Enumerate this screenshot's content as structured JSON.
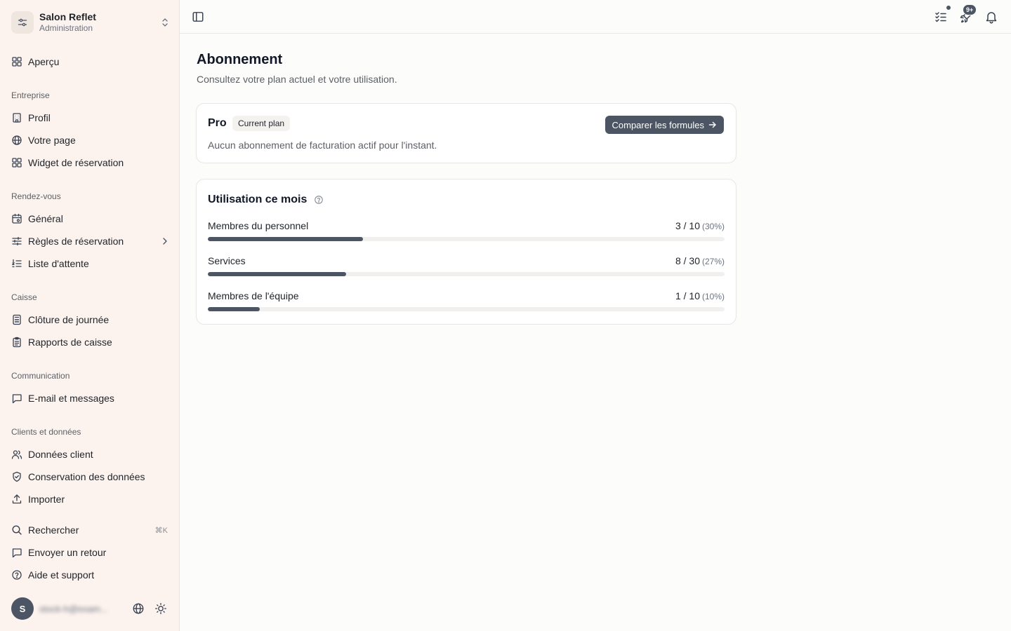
{
  "sidebar": {
    "org_name": "Salon Reflet",
    "org_role": "Administration",
    "overview": "Aperçu",
    "groups": {
      "entreprise": "Entreprise",
      "rendez_vous": "Rendez-vous",
      "caisse": "Caisse",
      "communication": "Communication",
      "clients": "Clients et données"
    },
    "items": {
      "profil": "Profil",
      "votre_page": "Votre page",
      "widget": "Widget de réservation",
      "general": "Général",
      "regles": "Règles de réservation",
      "liste_attente": "Liste d'attente",
      "cloture": "Clôture de journée",
      "rapports": "Rapports de caisse",
      "email": "E-mail et messages",
      "donnees_client": "Données client",
      "conservation": "Conservation des données",
      "importer": "Importer"
    },
    "search": "Rechercher",
    "search_shortcut": "⌘K",
    "feedback": "Envoyer un retour",
    "help": "Aide et support",
    "user_initial": "S",
    "user_email": "stock-h@exam..."
  },
  "topbar": {
    "whats_new_badge": "9+"
  },
  "main": {
    "title": "Abonnement",
    "subtitle": "Consultez votre plan actuel et votre utilisation.",
    "plan": {
      "name": "Pro",
      "badge": "Current plan",
      "compare_label": "Comparer les formules",
      "description": "Aucun abonnement de facturation actif pour l'instant."
    },
    "usage": {
      "title": "Utilisation ce mois",
      "rows": [
        {
          "label": "Membres du personnel",
          "value": "3 / 10",
          "pct_label": "(30%)",
          "fraction": 0.3
        },
        {
          "label": "Services",
          "value": "8 / 30",
          "pct_label": "(27%)",
          "fraction": 0.267
        },
        {
          "label": "Membres de l'équipe",
          "value": "1 / 10",
          "pct_label": "(10%)",
          "fraction": 0.1
        }
      ]
    }
  },
  "colors": {
    "accent": "#4b5563",
    "sidebar_bg": "#fdf3ee",
    "page_bg": "#fcfcfb"
  }
}
